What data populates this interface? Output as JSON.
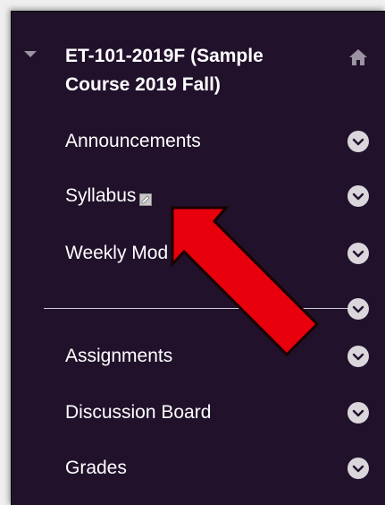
{
  "course": {
    "title": "ET-101-2019F (Sample Course 2019 Fall)",
    "title_line1": "ET-101-2019F (Sample",
    "title_line2": "Course 2019 Fall)"
  },
  "menu": {
    "items": [
      {
        "label": "Announcements"
      },
      {
        "label": "Syllabus"
      },
      {
        "label": "Weekly Mod"
      },
      {
        "label": "Assignments"
      },
      {
        "label": "Discussion Board"
      },
      {
        "label": "Grades"
      }
    ]
  },
  "icons": {
    "collapse": "caret-down-icon",
    "home": "home-icon",
    "chevron": "chevron-down-circle-icon",
    "edit": "edit-link-icon",
    "annotation": "red-arrow-pointer"
  },
  "colors": {
    "panel_bg": "#21112b",
    "text": "#ffffff",
    "chevron_bg": "#d9d6dc",
    "arrow": "#e8000d"
  }
}
